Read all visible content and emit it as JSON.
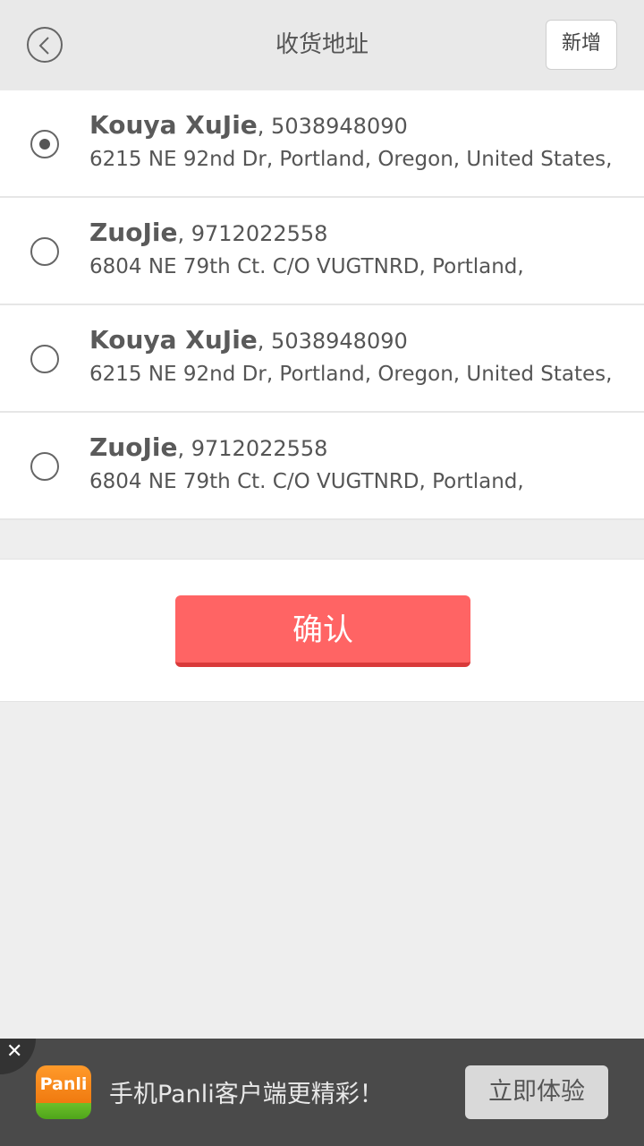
{
  "header": {
    "title": "收货地址",
    "add_label": "新增"
  },
  "addresses": [
    {
      "name": "Kouya XuJie",
      "phone": ", 5038948090",
      "address": "6215 NE 92nd Dr, Portland, Oregon, United States,",
      "selected": true
    },
    {
      "name": "ZuoJie",
      "phone": ", 9712022558",
      "address": "6804 NE 79th Ct. C/O VUGTNRD, Portland,",
      "selected": false
    },
    {
      "name": "Kouya XuJie",
      "phone": ", 5038948090",
      "address": "6215 NE 92nd Dr, Portland, Oregon, United States,",
      "selected": false
    },
    {
      "name": "ZuoJie",
      "phone": ", 9712022558",
      "address": "6804 NE 79th Ct. C/O VUGTNRD, Portland,",
      "selected": false
    }
  ],
  "confirm": {
    "label": "确认",
    "color": "#ff6464"
  },
  "banner": {
    "close_icon": "close-icon",
    "logo_text": "Panli",
    "text": "手机Panli客户端更精彩！",
    "button_label": "立即体验"
  }
}
